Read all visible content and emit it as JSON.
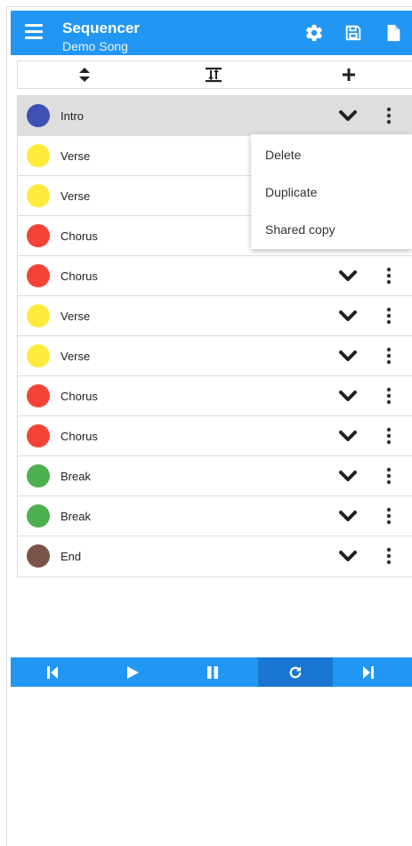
{
  "header": {
    "title": "Sequencer",
    "subtitle": "Demo Song",
    "bg_color": "#2196f3",
    "icons": [
      "menu-icon",
      "gear-icon",
      "save-icon",
      "document-icon"
    ]
  },
  "toolbar": {
    "icons": [
      "sort-icon",
      "sort-text-icon",
      "add-icon"
    ]
  },
  "parts": [
    {
      "label": "Intro",
      "color": "#3f51b5",
      "selected": true
    },
    {
      "label": "Verse",
      "color": "#ffeb3b"
    },
    {
      "label": "Verse",
      "color": "#ffeb3b"
    },
    {
      "label": "Chorus",
      "color": "#f44336"
    },
    {
      "label": "Chorus",
      "color": "#f44336"
    },
    {
      "label": "Verse",
      "color": "#ffeb3b"
    },
    {
      "label": "Verse",
      "color": "#ffeb3b"
    },
    {
      "label": "Chorus",
      "color": "#f44336"
    },
    {
      "label": "Chorus",
      "color": "#f44336"
    },
    {
      "label": "Break",
      "color": "#4caf50"
    },
    {
      "label": "Break",
      "color": "#4caf50"
    },
    {
      "label": "End",
      "color": "#795548"
    }
  ],
  "popup_menu": {
    "items": [
      "Delete",
      "Duplicate",
      "Shared copy"
    ]
  },
  "transport": {
    "buttons": [
      "skip-previous-icon",
      "play-icon",
      "pause-icon",
      "repeat-icon",
      "skip-next-icon"
    ],
    "active": "repeat-icon"
  }
}
